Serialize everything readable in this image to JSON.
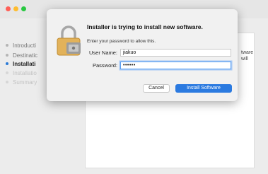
{
  "sidebar": {
    "steps": [
      {
        "label": "Introducti",
        "state": "done"
      },
      {
        "label": "Destinatic",
        "state": "done"
      },
      {
        "label": "Installati",
        "state": "active"
      },
      {
        "label": "Installatio",
        "state": "pending"
      },
      {
        "label": "Summary",
        "state": "pending"
      }
    ]
  },
  "background_text": {
    "line1": "tware",
    "line2": "will"
  },
  "dialog": {
    "title": "Installer is trying to install new software.",
    "subtitle": "Enter your password to allow this.",
    "username_label": "User Name:",
    "username_value": "jiakuo",
    "password_label": "Password:",
    "password_value": "••••••",
    "cancel_label": "Cancel",
    "install_label": "Install Software"
  },
  "colors": {
    "accent": "#2b7ae0",
    "traffic_close": "#ff5f57",
    "traffic_min": "#febc2e",
    "traffic_zoom": "#28c840"
  }
}
